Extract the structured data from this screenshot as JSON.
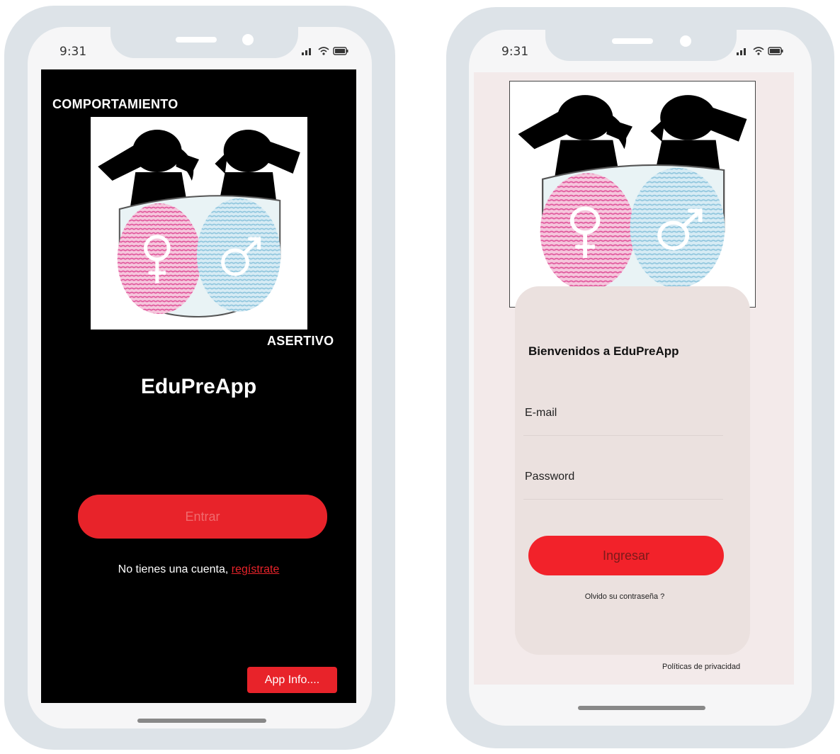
{
  "left_phone": {
    "status_time": "9:31",
    "top_label": "COMPORTAMIENTO",
    "bottom_label": "ASERTIVO",
    "app_title": "EduPreApp",
    "enter_button": "Entrar",
    "no_account_text": "No tienes una cuenta,",
    "register_link": "regístrate",
    "app_info_button": "App Info....",
    "icons": [
      "signal-icon",
      "wifi-icon",
      "battery-icon"
    ]
  },
  "right_phone": {
    "status_time": "9:31",
    "welcome": "Bienvenidos a EduPreApp",
    "email_placeholder": "E-mail",
    "password_placeholder": "Password",
    "login_button": "Ingresar",
    "forgot_link": "Olvido su contraseña ?",
    "privacy_link": "Políticas de privacidad",
    "icons": [
      "signal-icon",
      "wifi-icon",
      "battery-icon"
    ]
  },
  "colors": {
    "accent_red": "#e8232a",
    "frame": "#dde3e8",
    "female_pink": "#e0559b",
    "male_blue": "#8ec5dd"
  }
}
